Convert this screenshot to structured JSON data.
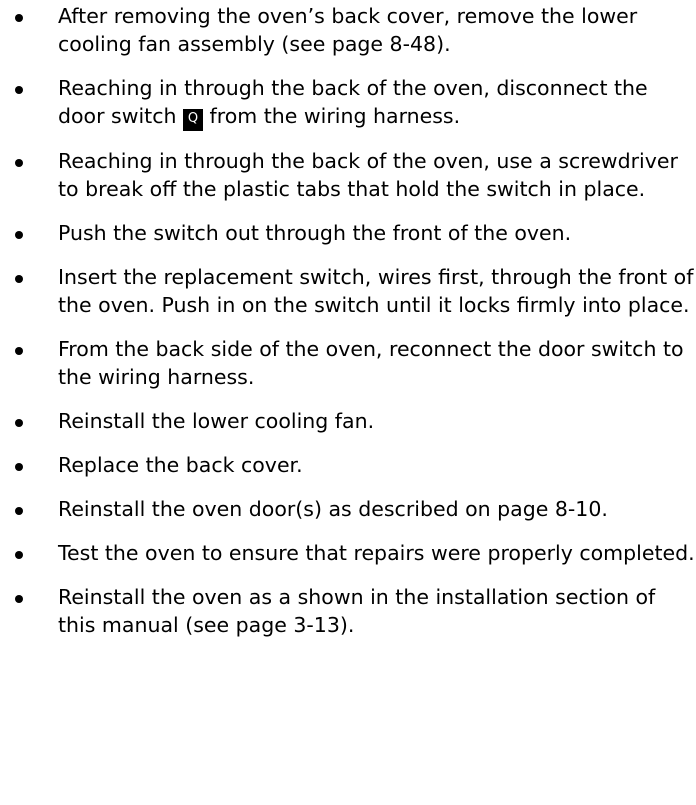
{
  "steps": [
    {
      "text": "After removing the oven’s back cover, remove the lower cooling fan assembly (see page 8-48)."
    },
    {
      "before": "Reaching in through the back of the oven, disconnect the door switch ",
      "callout": "Q",
      "after": " from the wiring harness."
    },
    {
      "text": "Reaching in through the back of the oven, use a screwdriver to break off the plastic tabs that hold the switch in place."
    },
    {
      "text": "Push the switch out through the front of the oven."
    },
    {
      "text": "Insert the replacement switch, wires first, through the front of the oven. Push in on the switch until it locks firmly into place."
    },
    {
      "text": "From the back side of the oven, reconnect the door switch to the wiring harness."
    },
    {
      "text": "Reinstall the lower cooling fan."
    },
    {
      "text": "Replace the back cover."
    },
    {
      "text": "Reinstall the oven door(s) as described on page 8-10."
    },
    {
      "text": "Test the oven to ensure that repairs were properly completed."
    },
    {
      "text": "Reinstall the oven as a shown in the installation section of this manual (see page 3-13)."
    }
  ]
}
